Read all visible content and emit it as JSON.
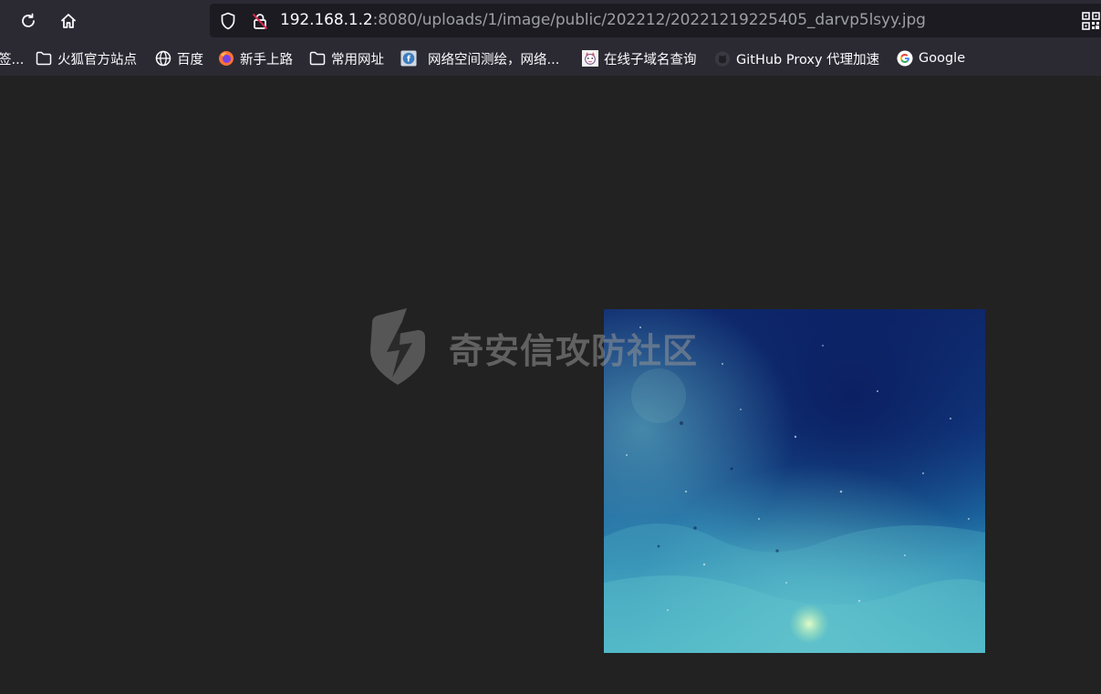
{
  "toolbar": {
    "reload_icon": "reload-icon",
    "home_icon": "home-icon"
  },
  "address_bar": {
    "host": "192.168.1.2",
    "rest": ":8080/uploads/1/image/public/202212/20221219225405_darvp5lsyy.jpg",
    "icons": [
      "shield-icon",
      "insecure-lock-icon",
      "qr-code-icon"
    ]
  },
  "bookmarks": [
    {
      "label": "签...",
      "icon": "folder-icon"
    },
    {
      "label": "火狐官方站点",
      "icon": "folder-icon"
    },
    {
      "label": "百度",
      "icon": "globe-icon"
    },
    {
      "label": "新手上路",
      "icon": "firefox-icon"
    },
    {
      "label": "常用网址",
      "icon": "folder-icon"
    },
    {
      "label": "网络空间测绘，网络...",
      "icon": "fofa-icon"
    },
    {
      "label": "在线子域名查询",
      "icon": "site-favicon-icon"
    },
    {
      "label": "GitHub Proxy 代理加速",
      "icon": "github-icon"
    },
    {
      "label": "Google",
      "icon": "google-icon"
    }
  ],
  "watermark": {
    "text": "奇安信攻防社区"
  },
  "colors": {
    "toolbar_bg": "#2b2a33",
    "url_bg": "#1c1b22",
    "page_bg": "#222222"
  }
}
